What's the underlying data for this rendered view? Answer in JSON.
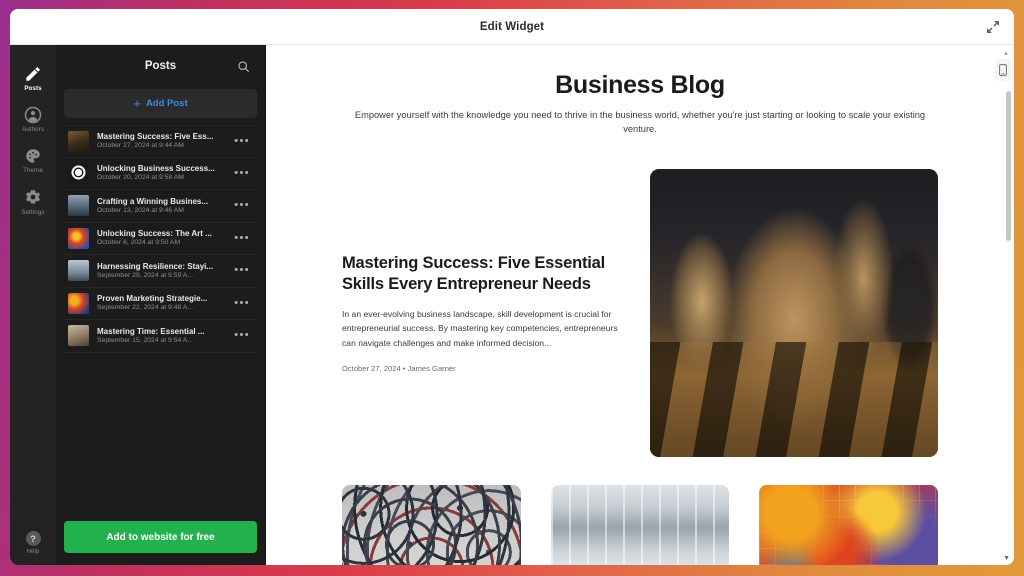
{
  "window": {
    "title": "Edit Widget",
    "expand_icon": "expand-arrows-icon"
  },
  "rail": {
    "items": [
      {
        "label": "Posts",
        "icon": "pencil-icon",
        "active": true
      },
      {
        "label": "Authors",
        "icon": "person-icon",
        "active": false
      },
      {
        "label": "Theme",
        "icon": "palette-icon",
        "active": false
      },
      {
        "label": "Settings",
        "icon": "gear-icon",
        "active": false
      }
    ],
    "help": {
      "label": "Help",
      "icon": "question-mark-icon"
    }
  },
  "panel": {
    "title": "Posts",
    "search_icon": "search-icon",
    "add_post_label": "Add Post",
    "add_post_plus": "+",
    "menu_glyph": "•••",
    "cta_label": "Add to website for free",
    "cta_color": "#22b14c",
    "accent_color": "#3f8ae0",
    "posts": [
      {
        "title": "Mastering Success: Five Ess...",
        "date": "October 27, 2024 at 9:44 AM",
        "thumb": "th-1"
      },
      {
        "title": "Unlocking Business Success...",
        "date": "October 20, 2024 at 9:58 AM",
        "thumb": "th-2"
      },
      {
        "title": "Crafting a Winning Busines...",
        "date": "October 13, 2024 at 9:46 AM",
        "thumb": "th-3"
      },
      {
        "title": "Unlocking Success: The Art ...",
        "date": "October 6, 2024 at 9:50 AM",
        "thumb": "th-4"
      },
      {
        "title": "Harnessing Resilience: Stayi...",
        "date": "September 29, 2024 at 9:59 A...",
        "thumb": "th-5"
      },
      {
        "title": "Proven Marketing Strategie...",
        "date": "September 22, 2024 at 9:48 A...",
        "thumb": "th-6"
      },
      {
        "title": "Mastering Time: Essential ...",
        "date": "September 15, 2024 at 9:54 A...",
        "thumb": "th-7"
      }
    ]
  },
  "preview": {
    "blog_title": "Business Blog",
    "blog_subtitle": "Empower yourself with the knowledge you need to thrive in the business world, whether you're just starting or looking to scale your existing venture.",
    "featured": {
      "heading": "Mastering Success: Five Essential Skills Every Entrepreneur Needs",
      "excerpt": "In an ever-evolving business landscape, skill development is crucial for entrepreneurial success. By mastering key competencies, entrepreneurs can navigate challenges and make informed decision...",
      "meta": "October 27, 2024 • James Garner",
      "image": "chess-board-photo"
    },
    "thumbnails": [
      {
        "image": "crowd-aerial-photo"
      },
      {
        "image": "office-interior-photo"
      },
      {
        "image": "colorful-puzzle-photo"
      }
    ],
    "device_toggle_icon": "mobile-device-icon",
    "scroll_up_glyph": "▲",
    "scroll_down_glyph": "▼"
  }
}
